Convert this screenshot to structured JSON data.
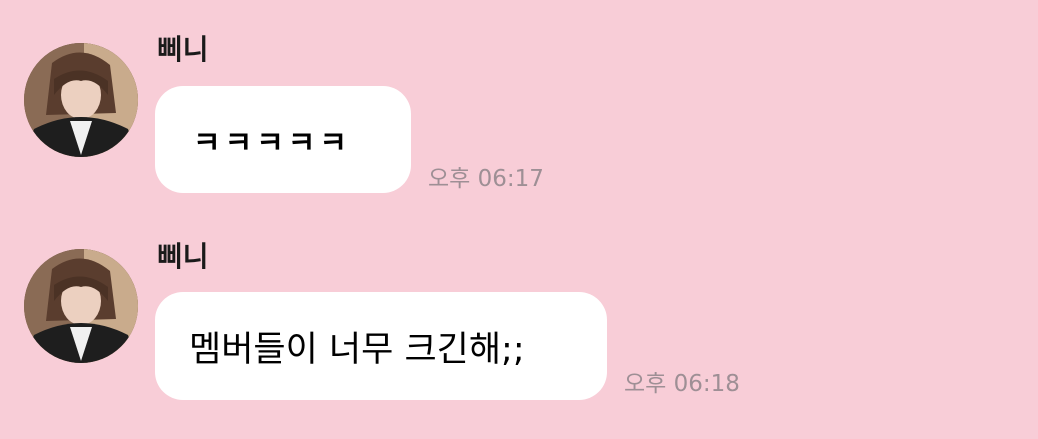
{
  "chat": {
    "background_color": "#f8cdd7",
    "messages": [
      {
        "sender": "삐니",
        "avatar_icon": "profile-photo",
        "text": "ㅋㅋㅋㅋㅋ",
        "time": "오후 06:17"
      },
      {
        "sender": "삐니",
        "avatar_icon": "profile-photo",
        "text": "멤버들이 너무 크긴해;;",
        "time": "오후 06:18"
      }
    ]
  }
}
